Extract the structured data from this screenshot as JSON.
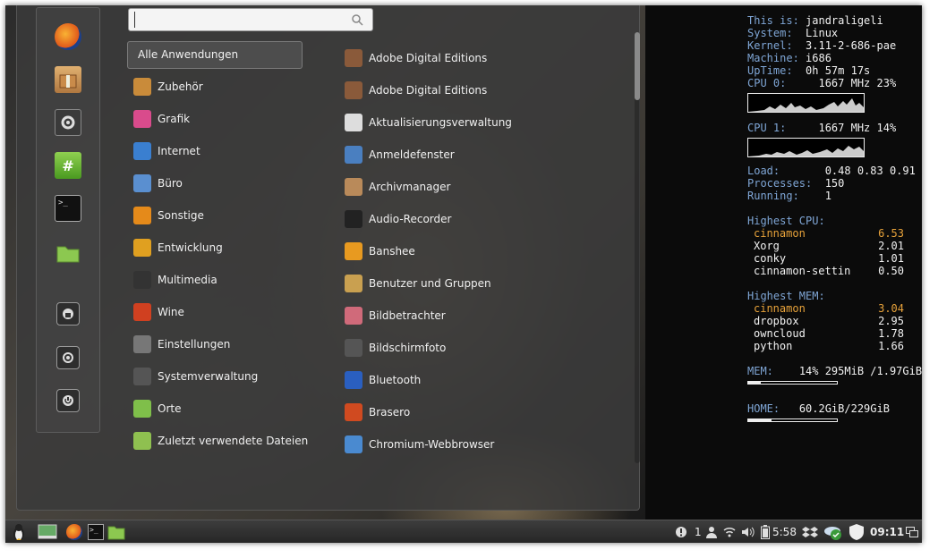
{
  "search": {
    "placeholder": "",
    "value": ""
  },
  "favorites": [
    {
      "name": "firefox-icon"
    },
    {
      "name": "package-icon"
    },
    {
      "name": "settings-icon"
    },
    {
      "name": "hashtag-icon"
    },
    {
      "name": "terminal-icon"
    },
    {
      "name": "folder-icon"
    },
    {
      "name": "lock-screen-icon"
    },
    {
      "name": "logout-icon"
    },
    {
      "name": "power-icon"
    }
  ],
  "categories": {
    "all": "Alle Anwendungen",
    "items": [
      {
        "label": "Zubehör",
        "color": "#c98b3a"
      },
      {
        "label": "Grafik",
        "color": "#d94b8c"
      },
      {
        "label": "Internet",
        "color": "#3a7fd0"
      },
      {
        "label": "Büro",
        "color": "#5a8fd0"
      },
      {
        "label": "Sonstige",
        "color": "#e58a1a"
      },
      {
        "label": "Entwicklung",
        "color": "#e0a020"
      },
      {
        "label": "Multimedia",
        "color": "#333333"
      },
      {
        "label": "Wine",
        "color": "#d04020"
      },
      {
        "label": "Einstellungen",
        "color": "#777777"
      },
      {
        "label": "Systemverwaltung",
        "color": "#555555"
      },
      {
        "label": "Orte",
        "color": "#7fbf4a"
      },
      {
        "label": "Zuletzt verwendete Dateien",
        "color": "#8fc050"
      }
    ]
  },
  "applications": [
    {
      "label": "Adobe Digital Editions",
      "color": "#8a5a3a"
    },
    {
      "label": "Adobe Digital Editions",
      "color": "#8a5a3a"
    },
    {
      "label": "Aktualisierungsverwaltung",
      "color": "#dddddd"
    },
    {
      "label": "Anmeldefenster",
      "color": "#4a7fc0"
    },
    {
      "label": "Archivmanager",
      "color": "#b98a5a"
    },
    {
      "label": "Audio-Recorder",
      "color": "#222222"
    },
    {
      "label": "Banshee",
      "color": "#e89a20"
    },
    {
      "label": "Benutzer und Gruppen",
      "color": "#c9a050"
    },
    {
      "label": "Bildbetrachter",
      "color": "#d06a7a"
    },
    {
      "label": "Bildschirmfoto",
      "color": "#555555"
    },
    {
      "label": "Bluetooth",
      "color": "#2a5fc0"
    },
    {
      "label": "Brasero",
      "color": "#d04a20"
    },
    {
      "label": "Chromium-Webbrowser",
      "color": "#4a8ad0"
    }
  ],
  "conky": {
    "this_is_label": "This is:",
    "this_is": "jandraligeli",
    "system_label": "System:",
    "system": "Linux",
    "kernel_label": "Kernel:",
    "kernel": "3.11-2-686-pae",
    "machine_label": "Machine:",
    "machine": "i686",
    "uptime_label": "UpTime:",
    "uptime": "0h 57m 17s",
    "cpu0_label": "CPU 0:",
    "cpu0_mhz": "1667 MHz",
    "cpu0_pct": "23%",
    "cpu1_label": "CPU 1:",
    "cpu1_mhz": "1667 MHz",
    "cpu1_pct": "14%",
    "load_label": "Load:",
    "load": "0.48 0.83 0.91",
    "processes_label": "Processes:",
    "processes": "150",
    "running_label": "Running:",
    "running": "1",
    "highest_cpu_label": "Highest CPU:",
    "highest_cpu": [
      {
        "name": "cinnamon",
        "value": "6.53"
      },
      {
        "name": "Xorg",
        "value": "2.01"
      },
      {
        "name": "conky",
        "value": "1.01"
      },
      {
        "name": "cinnamon-settin",
        "value": "0.50"
      }
    ],
    "highest_mem_label": "Highest MEM:",
    "highest_mem": [
      {
        "name": "cinnamon",
        "value": "3.04"
      },
      {
        "name": "dropbox",
        "value": "2.95"
      },
      {
        "name": "owncloud",
        "value": "1.78"
      },
      {
        "name": "python",
        "value": "1.66"
      }
    ],
    "mem_label": "MEM:",
    "mem": "14% 295MiB /1.97GiB",
    "mem_fraction": 0.14,
    "home_label": "HOME:",
    "home": "60.2GiB/229GiB",
    "home_fraction": 0.26
  },
  "panel": {
    "notifications_count": "1",
    "battery_time": "5:58",
    "clock": "09:11"
  },
  "colors": {
    "conky_label": "#7fa6d6",
    "conky_highlight": "#e7a23a",
    "menu_bg": "#3a3a3a"
  }
}
